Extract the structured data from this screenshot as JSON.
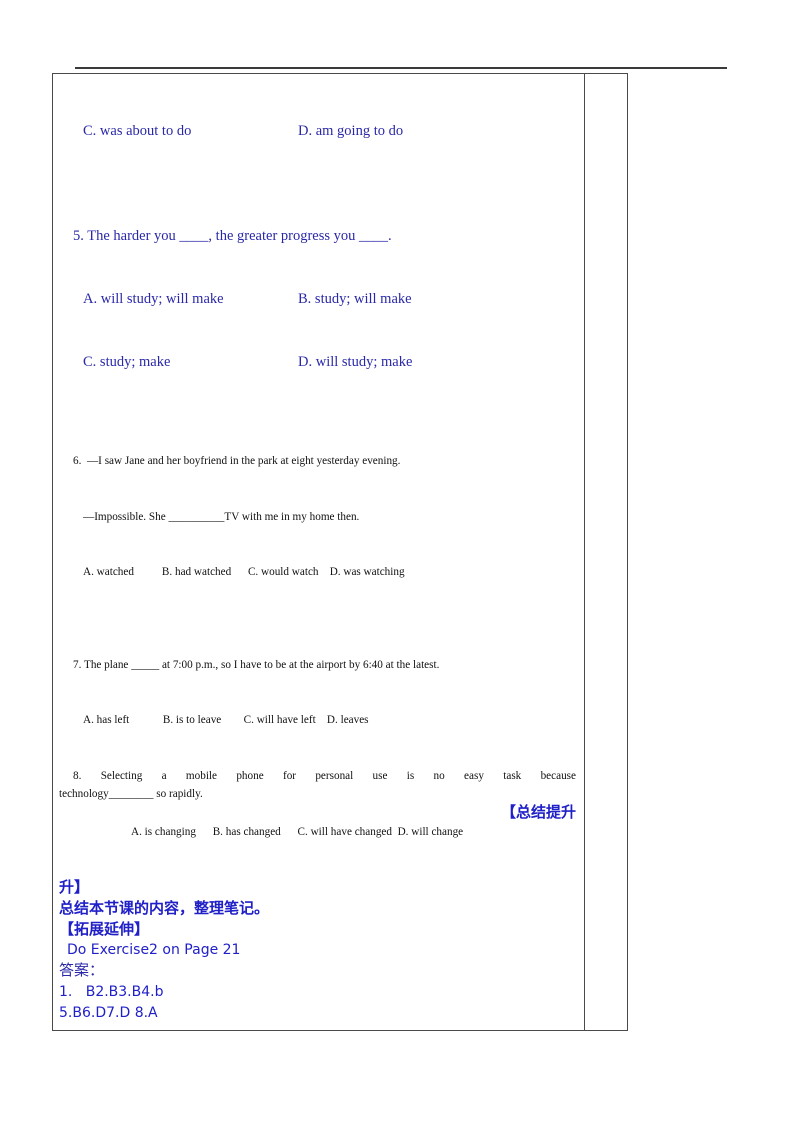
{
  "document": {
    "language": "zh-CN/en",
    "accent_blue": "#2020c8",
    "text_blue": "#2a28a8",
    "text_black": "#111111"
  },
  "questions": {
    "q4_options_tail": {
      "option_c": "C. was about to do",
      "option_d": "D. am going to do"
    },
    "q5": {
      "stem": "5. The harder you ____, the greater progress you ____.",
      "option_a": "A. will study; will make",
      "option_b": "B. study; will make",
      "option_c": "C. study; make",
      "option_d": "D. will study; make"
    },
    "q6": {
      "line1": "6.  —I saw Jane and her boyfriend in the park at eight yesterday evening.",
      "line2": "—Impossible. She __________TV with me in my home then.",
      "options": "A. watched          B. had watched      C. would watch    D. was watching"
    },
    "q7": {
      "stem": "7. The plane _____ at 7:00 p.m., so I have to be at the airport by 6:40 at the latest.",
      "options": "A. has left            B. is to leave        C. will have left    D. leaves"
    },
    "q8": {
      "stem_line1": "8. Selecting a mobile phone for personal use is no easy task because",
      "stem_line2": "technology________ so rapidly.",
      "options": "A. is changing      B. has changed      C. will have changed  D. will change"
    }
  },
  "sections": {
    "summary_heading": "【总结提升",
    "summary_heading_wrap": "升】",
    "summary_body": "总结本节课的内容，整理笔记。",
    "extension_heading": "【拓展延伸】",
    "extension_body": "Do Exercise2 on Page 21",
    "answers_label": "答案：",
    "answers_line1": "1.   B2.B3.B4.b",
    "answers_line2": "5.B6.D7.D 8.A"
  }
}
